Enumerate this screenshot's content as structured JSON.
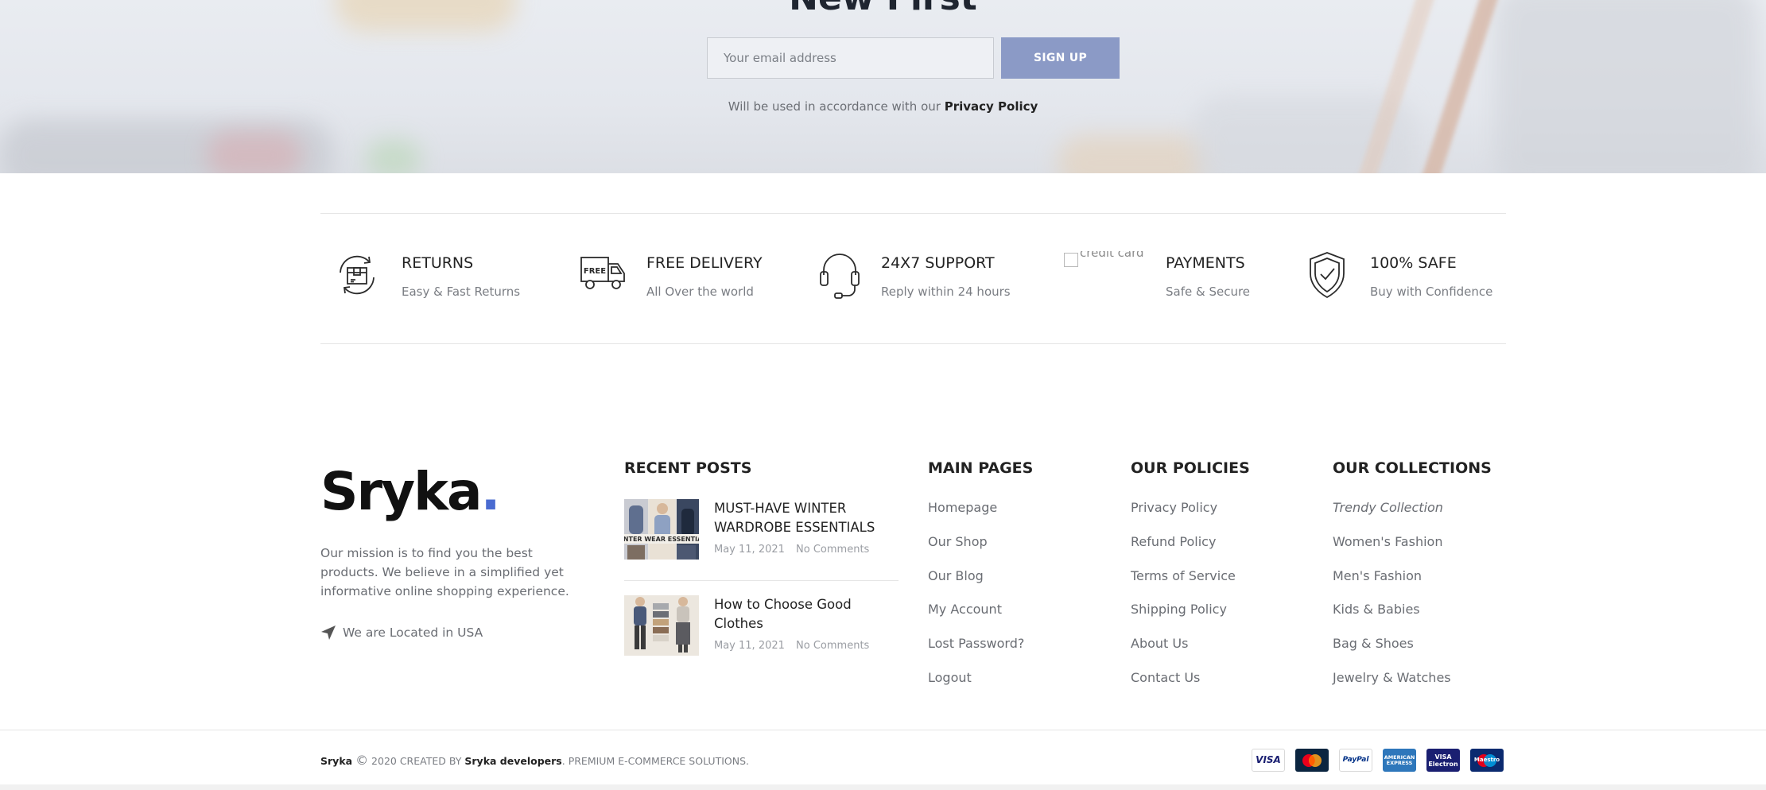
{
  "newsletter": {
    "heading": "New First",
    "email_placeholder": "Your email address",
    "signup_label": "SIGN UP",
    "note_prefix": "Will be used in accordance with our",
    "note_link": "Privacy Policy"
  },
  "features": [
    {
      "title": "RETURNS",
      "subtitle": "Easy & Fast Returns",
      "icon": "returns-box-icon"
    },
    {
      "title": "FREE DELIVERY",
      "subtitle": "All Over the world",
      "icon": "delivery-truck-icon",
      "icon_text": "FREE"
    },
    {
      "title": "24X7 SUPPORT",
      "subtitle": "Reply within 24 hours",
      "icon": "headset-icon"
    },
    {
      "title": "PAYMENTS",
      "subtitle": "Safe & Secure",
      "icon": "broken-image-icon",
      "icon_alt": "credit card"
    },
    {
      "title": "100% SAFE",
      "subtitle": "Buy with Confidence",
      "icon": "shield-check-icon"
    }
  ],
  "brand": {
    "logo_text": "Sryka",
    "logo_dot": ".",
    "mission": "Our mission is to find you the best products. We believe in a simplified yet informative online shopping experience.",
    "location": "We are Located in USA",
    "accent": "#4a6bd1"
  },
  "recent_posts": {
    "title": "RECENT POSTS",
    "posts": [
      {
        "title": "MUST-HAVE WINTER WARDROBE ESSENTIALS",
        "date": "May 11, 2021",
        "comments": "No Comments",
        "thumb_text": "INTER WEAR ESSENTIA"
      },
      {
        "title": "How to Choose Good Clothes",
        "date": "May 11, 2021",
        "comments": "No Comments"
      }
    ]
  },
  "main_pages": {
    "title": "MAIN PAGES",
    "links": [
      "Homepage",
      "Our Shop",
      "Our Blog",
      "My Account",
      "Lost Password?",
      "Logout"
    ]
  },
  "policies": {
    "title": "OUR POLICIES",
    "links": [
      "Privacy Policy",
      "Refund Policy",
      "Terms of Service",
      "Shipping Policy",
      "About Us",
      "Contact Us"
    ]
  },
  "collections": {
    "title": "OUR COLLECTIONS",
    "links": [
      "Trendy Collection",
      "Women's Fashion",
      "Men's Fashion",
      "Kids & Babies",
      "Bag & Shoes",
      "Jewelry & Watches"
    ]
  },
  "footer_bottom": {
    "brand": "Sryka",
    "copyright_symbol": "©",
    "year_text": "2020 CREATED BY",
    "developer": "Sryka developers",
    "suffix": ". PREMIUM E-COMMERCE SOLUTIONS.",
    "payment_icons": [
      {
        "name": "visa-icon",
        "label": "VISA",
        "bg": "#ffffff",
        "fg": "#1a1f71"
      },
      {
        "name": "mastercard-icon",
        "label": "",
        "bg": "#0b2540",
        "fg": "#ffffff"
      },
      {
        "name": "paypal-icon",
        "label": "PayPal",
        "bg": "#ffffff",
        "fg": "#003087"
      },
      {
        "name": "american-express-icon",
        "label": "AMERICAN EXPRESS",
        "bg": "#2e77bb",
        "fg": "#ffffff"
      },
      {
        "name": "visa-electron-icon",
        "label": "VISA Electron",
        "bg": "#1a1f71",
        "fg": "#ffffff"
      },
      {
        "name": "maestro-icon",
        "label": "Maestro",
        "bg": "#0b2a6f",
        "fg": "#ffffff"
      }
    ]
  }
}
